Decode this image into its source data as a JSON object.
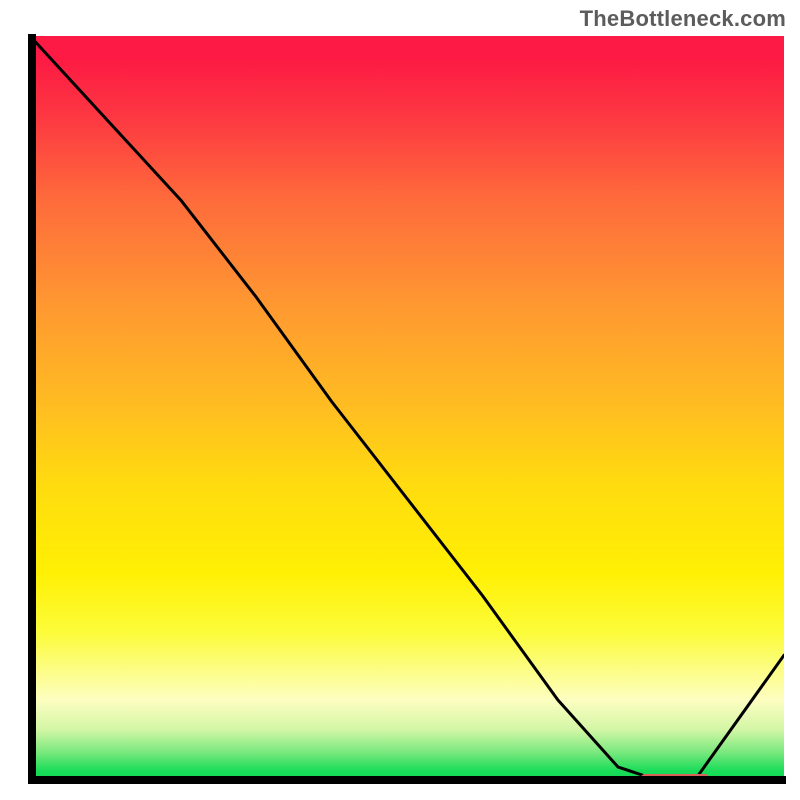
{
  "watermark": "TheBottleneck.com",
  "colors": {
    "curve": "#000000",
    "marker": "#d6625a",
    "axis": "#000000"
  },
  "chart_data": {
    "type": "line",
    "title": "",
    "xlabel": "",
    "ylabel": "",
    "xlim": [
      0,
      100
    ],
    "ylim": [
      0,
      100
    ],
    "x": [
      0,
      10,
      20,
      30,
      40,
      50,
      60,
      70,
      78,
      84,
      88,
      100
    ],
    "values": [
      100,
      89,
      78,
      65,
      51,
      38,
      25,
      11,
      2,
      0,
      0,
      17
    ],
    "optimum_band": {
      "x_start": 81,
      "x_end": 90,
      "y": 0.6
    },
    "background_gradient": "red-yellow-green vertical bottleneck heatmap"
  }
}
